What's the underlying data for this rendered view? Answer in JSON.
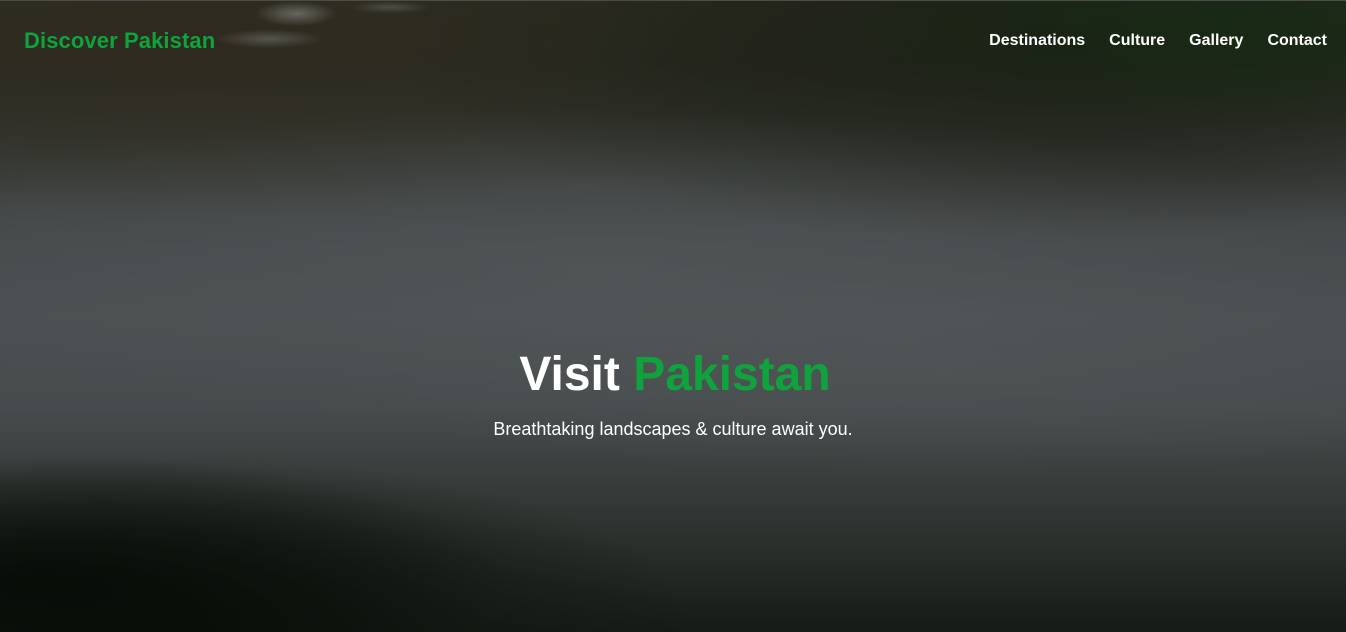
{
  "navbar": {
    "brand": "Discover Pakistan",
    "links": [
      {
        "label": "Destinations"
      },
      {
        "label": "Culture"
      },
      {
        "label": "Gallery"
      },
      {
        "label": "Contact"
      }
    ]
  },
  "hero": {
    "title_part1": "Visit",
    "title_part2": "Pakistan",
    "subtitle": "Breathtaking landscapes & culture await you."
  },
  "colors": {
    "accent": "#10a23c",
    "text": "#ffffff"
  }
}
